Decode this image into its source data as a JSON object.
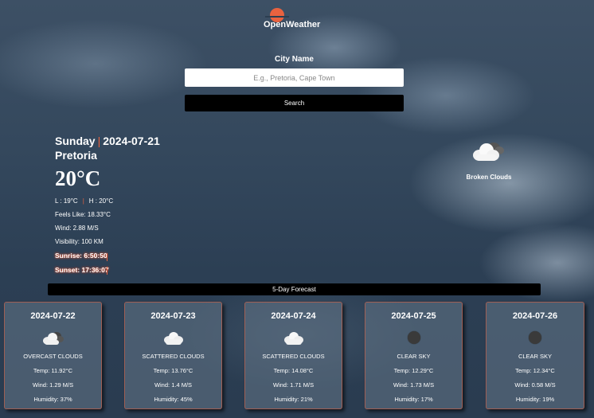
{
  "brand": {
    "name": "OpenWeather",
    "accent": "#e8623f"
  },
  "search": {
    "label": "City Name",
    "placeholder": "E.g., Pretoria, Cape Town",
    "button_label": "Search"
  },
  "current": {
    "day": "Sunday",
    "date": "2024-07-21",
    "city": "Pretoria",
    "temp": "20°C",
    "low": "L : 19°C",
    "high": "H : 20°C",
    "feels_like": "Feels Like: 18.33°C",
    "wind": "Wind: 2.88 M/S",
    "visibility": "Visibility: 100 KM",
    "sunrise": "Sunrise: 6:50:50",
    "sunset": "Sunset: 17:36:07",
    "condition": "Broken Clouds",
    "condition_icon": "broken-clouds-icon"
  },
  "forecast": {
    "title": "5-Day Forecast",
    "days": [
      {
        "date": "2024-07-22",
        "condition": "OVERCAST CLOUDS",
        "icon": "overcast-clouds-icon",
        "temp": "Temp: 11.92°C",
        "wind": "Wind: 1.29 M/S",
        "humidity": "Humidity: 37%"
      },
      {
        "date": "2024-07-23",
        "condition": "SCATTERED CLOUDS",
        "icon": "scattered-clouds-icon",
        "temp": "Temp: 13.76°C",
        "wind": "Wind: 1.4 M/S",
        "humidity": "Humidity: 45%"
      },
      {
        "date": "2024-07-24",
        "condition": "SCATTERED CLOUDS",
        "icon": "scattered-clouds-icon",
        "temp": "Temp: 14.08°C",
        "wind": "Wind: 1.71 M/S",
        "humidity": "Humidity: 21%"
      },
      {
        "date": "2024-07-25",
        "condition": "CLEAR SKY",
        "icon": "clear-sky-night-icon",
        "temp": "Temp: 12.29°C",
        "wind": "Wind: 1.73 M/S",
        "humidity": "Humidity: 17%"
      },
      {
        "date": "2024-07-26",
        "condition": "CLEAR SKY",
        "icon": "clear-sky-night-icon",
        "temp": "Temp: 12.34°C",
        "wind": "Wind: 0.58 M/S",
        "humidity": "Humidity: 19%"
      }
    ]
  }
}
